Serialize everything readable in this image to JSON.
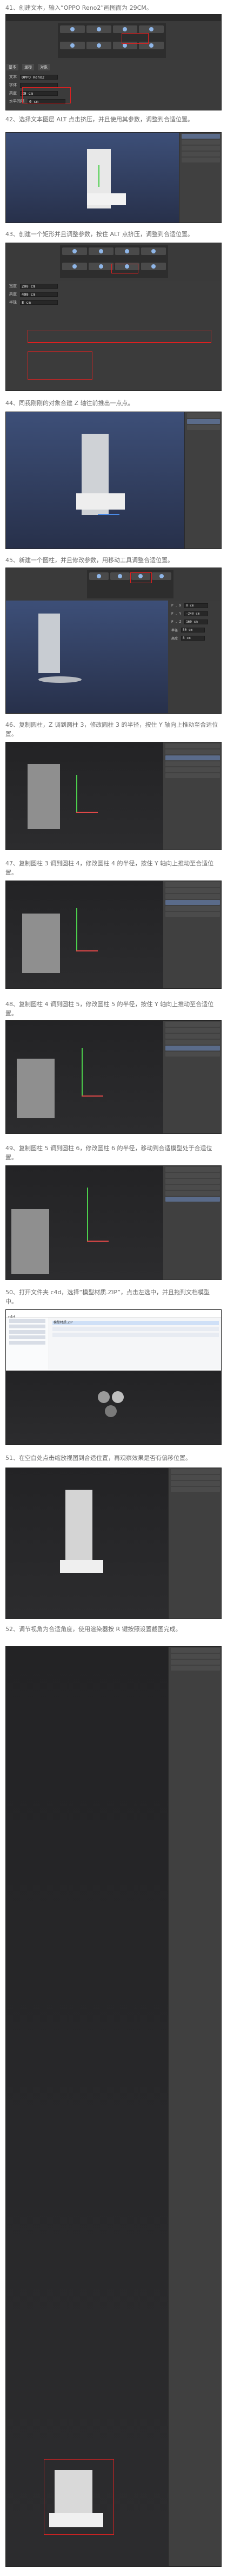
{
  "steps": [
    {
      "id": "41",
      "text": "41、创建文本，输入“OPPO Reno2”画图面为 29CM。"
    },
    {
      "id": "42",
      "text": "42、选择文本图层 ALT 点击挤压，并且使用其参数，调整到合适位置。"
    },
    {
      "id": "43",
      "text": "43、创建一个矩形并且调整参数，按住 ALT 点挤压，调整到合适位置。"
    },
    {
      "id": "44",
      "text": "44、同我刚刚的对象合建 Z 轴往前推出一点点。"
    },
    {
      "id": "45",
      "text": "45、新建一个圆柱，并且修改参数，用移动工具调整合适位置。"
    },
    {
      "id": "46",
      "text": "46、复制圆柱，Z 调到圆柱 3，修改圆柱 3 的半径，按住 Y 轴向上推动至合适位置。"
    },
    {
      "id": "47",
      "text": "47、复制圆柱 3 调到圆柱 4，修改圆柱 4 的半径，按住 Y 轴向上推动至合适位置。"
    },
    {
      "id": "48",
      "text": "48、复制圆柱 4 调到圆柱 5，修改圆柱 5 的半径，按住 Y 轴向上推动至合适位置。"
    },
    {
      "id": "49",
      "text": "49、复制圆柱 5 调到圆柱 6，修改圆柱 6 的半径，移动到合适模型处于合适位置。"
    },
    {
      "id": "50",
      "text": "50、打开文件夹 c4d，选择“模型材质.ZIP”，点击左选中，并且拖到文档模型中。"
    },
    {
      "id": "51",
      "text": "51、在空白处点击缩放视图到合适位置，再观察效果是否有偏移位置。"
    },
    {
      "id": "52",
      "text": "52、调节视角为合适角度，使用渲染器按 R 键按照设置截图完成。"
    }
  ],
  "panel41": {
    "tab_basic": "基本",
    "tab_coord": "坐标",
    "tab_obj": "对象",
    "label_text": "文本",
    "value_text": "OPPO Reno2",
    "label_font": "字体",
    "label_height": "高度",
    "value_height": "29 cm",
    "label_spacing": "水平间隔",
    "value_spacing": "0 cm"
  },
  "panel43": {
    "label_w": "宽度",
    "value_w": "200 cm",
    "label_h": "高度",
    "value_h": "400 cm",
    "label_r": "半径",
    "value_r": "8 cm"
  },
  "panel45": {
    "label_p": "P . X",
    "value_px": "0 cm",
    "label_py": "P . Y",
    "value_py": "-240 cm",
    "label_pz": "P . Z",
    "value_pz": "160 cm",
    "label_rad": "半径",
    "value_rad": "50 cm",
    "label_height": "高度",
    "value_height": "8 cm"
  },
  "explorer50": {
    "title": "c4d",
    "file": "模型材质.ZIP"
  }
}
